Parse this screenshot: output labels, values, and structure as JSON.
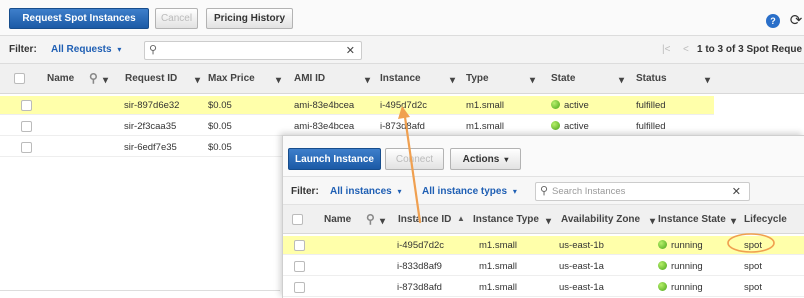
{
  "spot": {
    "toolbar": {
      "request_label": "Request Spot Instances",
      "cancel_label": "Cancel",
      "pricing_label": "Pricing History"
    },
    "filter": {
      "label": "Filter:",
      "value": "All Requests",
      "search_placeholder": "",
      "paging": "1 to 3 of 3 Spot Reque"
    },
    "columns": {
      "name": "Name",
      "request_id": "Request ID",
      "max_price": "Max Price",
      "ami_id": "AMI ID",
      "instance": "Instance",
      "type": "Type",
      "state": "State",
      "status": "Status"
    },
    "rows": [
      {
        "request_id": "sir-897d6e32",
        "max_price": "$0.05",
        "ami_id": "ami-83e4bcea",
        "instance": "i-495d7d2c",
        "type": "m1.small",
        "state": "active",
        "status": "fulfilled",
        "highlight": true
      },
      {
        "request_id": "sir-2f3caa35",
        "max_price": "$0.05",
        "ami_id": "ami-83e4bcea",
        "instance": "i-873d8afd",
        "type": "m1.small",
        "state": "active",
        "status": "fulfilled",
        "highlight": false
      },
      {
        "request_id": "sir-6edf7e35",
        "max_price": "$0.05",
        "ami_id": "",
        "instance": "",
        "type": "",
        "state": "",
        "status": "",
        "highlight": false
      }
    ]
  },
  "instances": {
    "toolbar": {
      "launch_label": "Launch Instance",
      "connect_label": "Connect",
      "actions_label": "Actions"
    },
    "filter": {
      "label": "Filter:",
      "instances_value": "All instances",
      "types_value": "All instance types",
      "search_placeholder": "Search Instances"
    },
    "columns": {
      "name": "Name",
      "instance_id": "Instance ID",
      "instance_type": "Instance Type",
      "availability_zone": "Availability Zone",
      "instance_state": "Instance State",
      "lifecycle": "Lifecycle"
    },
    "rows": [
      {
        "instance_id": "i-495d7d2c",
        "instance_type": "m1.small",
        "availability_zone": "us-east-1b",
        "instance_state": "running",
        "lifecycle": "spot",
        "highlight": true
      },
      {
        "instance_id": "i-833d8af9",
        "instance_type": "m1.small",
        "availability_zone": "us-east-1a",
        "instance_state": "running",
        "lifecycle": "spot",
        "highlight": false
      },
      {
        "instance_id": "i-873d8afd",
        "instance_type": "m1.small",
        "availability_zone": "us-east-1a",
        "instance_state": "running",
        "lifecycle": "spot",
        "highlight": false
      }
    ]
  },
  "colors": {
    "highlight": "#ffffaa",
    "accent": "#1f5fb4",
    "callout": "#f0a050",
    "running": "#4aa518"
  }
}
